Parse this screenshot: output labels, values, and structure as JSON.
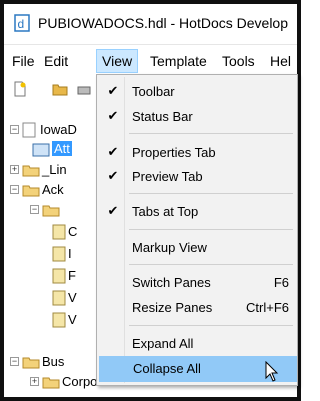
{
  "window": {
    "title": "PUBIOWADOCS.hdl - HotDocs Develop"
  },
  "menubar": {
    "items": [
      {
        "label": "File"
      },
      {
        "label": "Edit"
      },
      {
        "label": "View"
      },
      {
        "label": "Template"
      },
      {
        "label": "Tools"
      },
      {
        "label": "Hel"
      }
    ]
  },
  "tree": {
    "nodes": [
      {
        "label": "IowaD"
      },
      {
        "label": "Att"
      },
      {
        "label": "_Lin"
      },
      {
        "label": "Ack"
      },
      {
        "label": ""
      },
      {
        "label": "C"
      },
      {
        "label": "I"
      },
      {
        "label": "F"
      },
      {
        "label": "V"
      },
      {
        "label": "V"
      },
      {
        "label": "Bus"
      },
      {
        "label": "Corporations"
      }
    ]
  },
  "view_menu": {
    "items": [
      {
        "label": "Toolbar",
        "checked": true,
        "shortcut": ""
      },
      {
        "label": "Status Bar",
        "checked": true,
        "shortcut": ""
      },
      {
        "label": "Properties Tab",
        "checked": true,
        "shortcut": ""
      },
      {
        "label": "Preview Tab",
        "checked": true,
        "shortcut": ""
      },
      {
        "label": "Tabs at Top",
        "checked": true,
        "shortcut": ""
      },
      {
        "label": "Markup View",
        "checked": false,
        "shortcut": ""
      },
      {
        "label": "Switch Panes",
        "checked": false,
        "shortcut": "F6"
      },
      {
        "label": "Resize Panes",
        "checked": false,
        "shortcut": "Ctrl+F6"
      },
      {
        "label": "Expand All",
        "checked": false,
        "shortcut": ""
      },
      {
        "label": "Collapse All",
        "checked": false,
        "shortcut": ""
      }
    ],
    "check_mark": "✔"
  },
  "colors": {
    "menu_highlight": "#91c9f7",
    "tree_selection": "#3399ff",
    "app_icon": "#2b78c2"
  }
}
